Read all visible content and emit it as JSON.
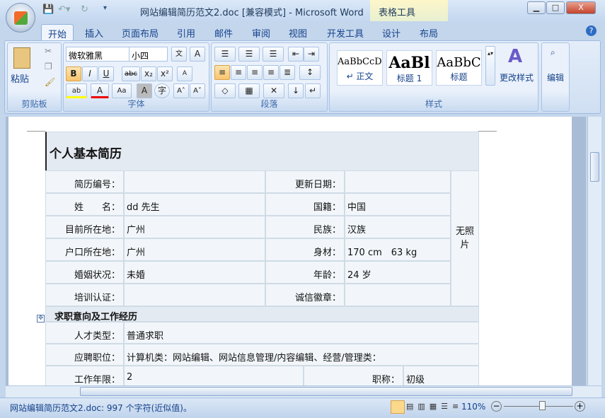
{
  "window": {
    "title": "网站编辑简历范文2.doc [兼容模式] - Microsoft Word",
    "context_tab_group": "表格工具",
    "minimize": "▁",
    "maximize": "□",
    "close": "X"
  },
  "tabs": [
    "开始",
    "插入",
    "页面布局",
    "引用",
    "邮件",
    "审阅",
    "视图",
    "开发工具",
    "设计",
    "布局"
  ],
  "help": "?",
  "ribbon": {
    "clipboard": {
      "paste": "粘贴",
      "label": "剪贴板"
    },
    "font": {
      "name": "微软雅黑",
      "size": "小四",
      "label": "字体",
      "bold": "B",
      "italic": "I",
      "underline": "U",
      "strike": "abc",
      "sub": "x₂",
      "sup": "x²",
      "case": "Aa",
      "charshade": "A",
      "enclose": "字",
      "grow": "A˄",
      "shrink": "A˅",
      "phonetic": "文",
      "border": "A",
      "highlight": "ab",
      "color": "A",
      "clear": "A"
    },
    "paragraph": {
      "label": "段落"
    },
    "styles": {
      "items": [
        {
          "preview": "AaBbCcDc",
          "name": "↵ 正文"
        },
        {
          "preview": "AaBl",
          "name": "标题 1"
        },
        {
          "preview": "AaBbC",
          "name": "标题"
        }
      ],
      "change": "更改样式",
      "label": "样式"
    },
    "editing": {
      "label": "编辑"
    }
  },
  "document": {
    "title": "个人基本简历",
    "rows": [
      [
        "简历编号：",
        "",
        "更新日期：",
        ""
      ],
      [
        "姓　　名：",
        "dd 先生",
        "国籍：",
        "中国"
      ],
      [
        "目前所在地：",
        "广州",
        "民族：",
        "汉族"
      ],
      [
        "户口所在地：",
        "广州",
        "身材：",
        "170 cm　63 kg"
      ],
      [
        "婚姻状况：",
        "未婚",
        "年龄：",
        "24 岁"
      ],
      [
        "培训认证：",
        "",
        "诚信徽章：",
        ""
      ]
    ],
    "photo": "无照\n片",
    "section": "求职意向及工作经历",
    "rows2": [
      [
        "人才类型：",
        "普通求职"
      ],
      [
        "应聘职位：",
        "计算机类：网站编辑、网站信息管理/内容编辑、经营/管理类："
      ]
    ],
    "last_row": [
      "工作年限：",
      "2",
      "职称：",
      "初级"
    ]
  },
  "status": {
    "text": "网站编辑简历范文2.doc: 997 个字符(近似值)。",
    "zoom": "110%",
    "zoom_fraction": 0.55
  }
}
